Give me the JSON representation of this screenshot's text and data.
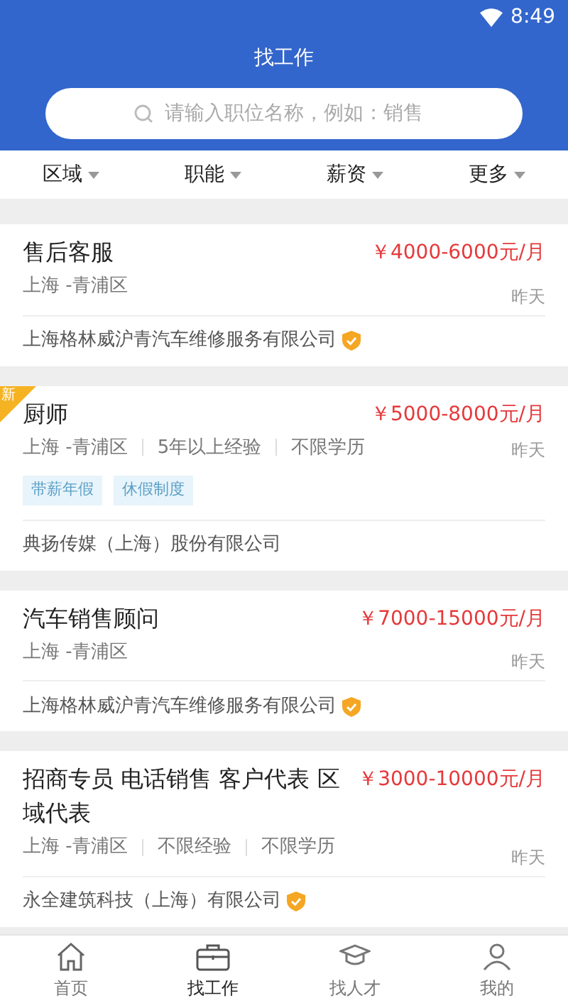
{
  "status_bar": {
    "time": "8:49"
  },
  "header": {
    "title": "找工作"
  },
  "search": {
    "placeholder": "请输入职位名称，例如：销售"
  },
  "filters": [
    "区域",
    "职能",
    "薪资",
    "更多"
  ],
  "jobs": [
    {
      "title": "售后客服",
      "salary": "￥4000-6000元/月",
      "meta": [
        "上海 -青浦区"
      ],
      "time": "昨天",
      "company": "上海格林威沪青汽车维修服务有限公司",
      "verified": true,
      "new": false
    },
    {
      "title": "厨师",
      "salary": "￥5000-8000元/月",
      "meta": [
        "上海 -青浦区",
        "5年以上经验",
        "不限学历"
      ],
      "tags": [
        "带薪年假",
        "休假制度"
      ],
      "time": "昨天",
      "company": "典扬传媒（上海）股份有限公司",
      "verified": false,
      "new": true,
      "new_label": "新"
    },
    {
      "title": "汽车销售顾问",
      "salary": "￥7000-15000元/月",
      "meta": [
        "上海 -青浦区"
      ],
      "time": "昨天",
      "company": "上海格林威沪青汽车维修服务有限公司",
      "verified": true,
      "new": false
    },
    {
      "title": "招商专员 电话销售 客户代表 区域代表",
      "salary": "￥3000-10000元/月",
      "meta": [
        "上海 -青浦区",
        "不限经验",
        "不限学历"
      ],
      "time": "昨天",
      "company": "永全建筑科技（上海）有限公司",
      "verified": true,
      "new": false
    }
  ],
  "tab_bar": [
    {
      "kind": "home",
      "label": "首页",
      "selected": false
    },
    {
      "kind": "briefcase",
      "label": "找工作",
      "selected": true
    },
    {
      "kind": "talent",
      "label": "找人才",
      "selected": false
    },
    {
      "kind": "person",
      "label": "我的",
      "selected": false
    }
  ]
}
